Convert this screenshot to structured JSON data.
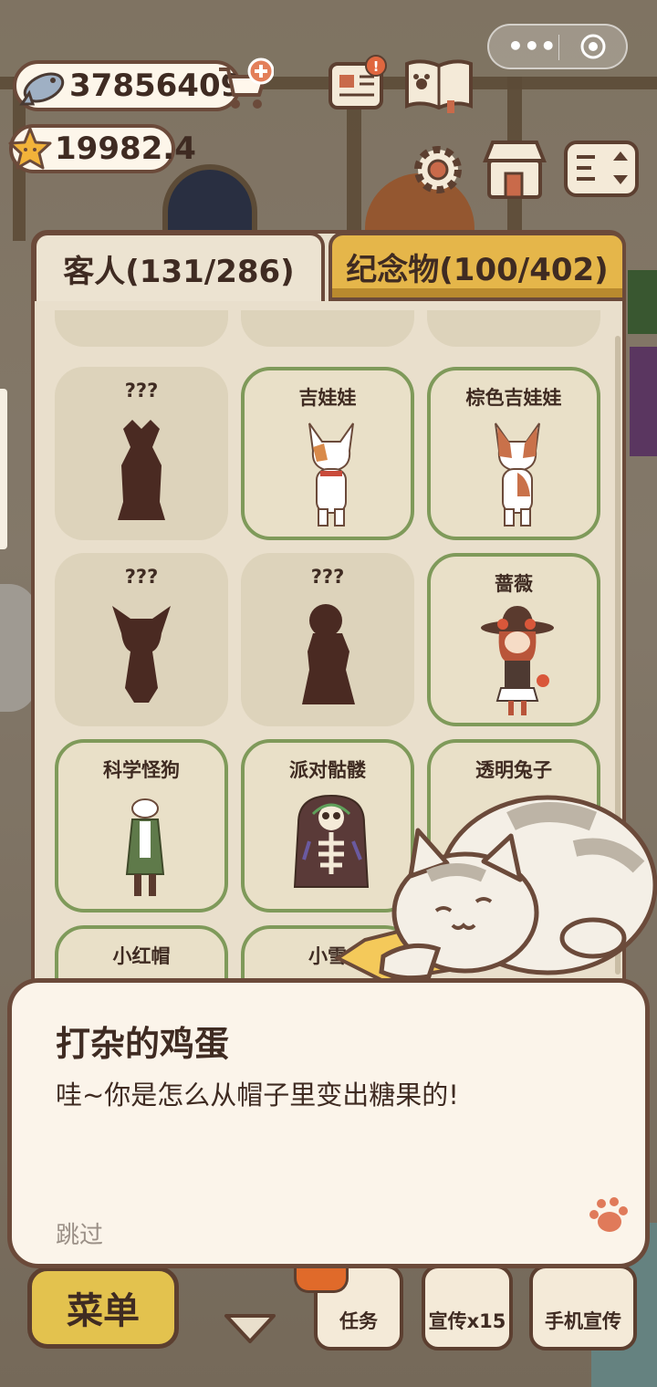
{
  "currency": {
    "fish": "37856409",
    "stars": "19982.4"
  },
  "icons": {
    "fish": "fish-icon",
    "star": "star-icon",
    "cart": "cart-plus-icon",
    "news": "newspaper-icon",
    "book": "paw-book-icon",
    "settings": "gear-icon",
    "shop": "shop-icon",
    "layout": "layout-icon",
    "more": "more-dots-icon",
    "close": "target-icon",
    "paw": "paw-icon",
    "chevron": "chevron-down-icon"
  },
  "tabs": {
    "guests": "客人(131/286)",
    "souvenirs": "纪念物(100/402)"
  },
  "cards": [
    {
      "name": "???",
      "unlocked": false
    },
    {
      "name": "吉娃娃",
      "unlocked": true
    },
    {
      "name": "棕色吉娃娃",
      "unlocked": true
    },
    {
      "name": "???",
      "unlocked": false
    },
    {
      "name": "???",
      "unlocked": false
    },
    {
      "name": "蔷薇",
      "unlocked": true
    },
    {
      "name": "科学怪狗",
      "unlocked": true
    },
    {
      "name": "派对骷髅",
      "unlocked": true
    },
    {
      "name": "透明兔子",
      "unlocked": true
    },
    {
      "name": "小红帽",
      "unlocked": true
    },
    {
      "name": "小雪",
      "unlocked": true
    }
  ],
  "dialog": {
    "speaker": "打杂的鸡蛋",
    "text": "哇~你是怎么从帽子里变出糖果的!",
    "skip": "跳过"
  },
  "bottom": {
    "menu": "菜单",
    "tasks": "任务",
    "promo": "宣传x15",
    "phone_promo": "手机宣传"
  },
  "colors": {
    "accent_gold": "#e5b64a",
    "unlocked_border": "#7f9a5a",
    "brown": "#6b4a3a"
  }
}
